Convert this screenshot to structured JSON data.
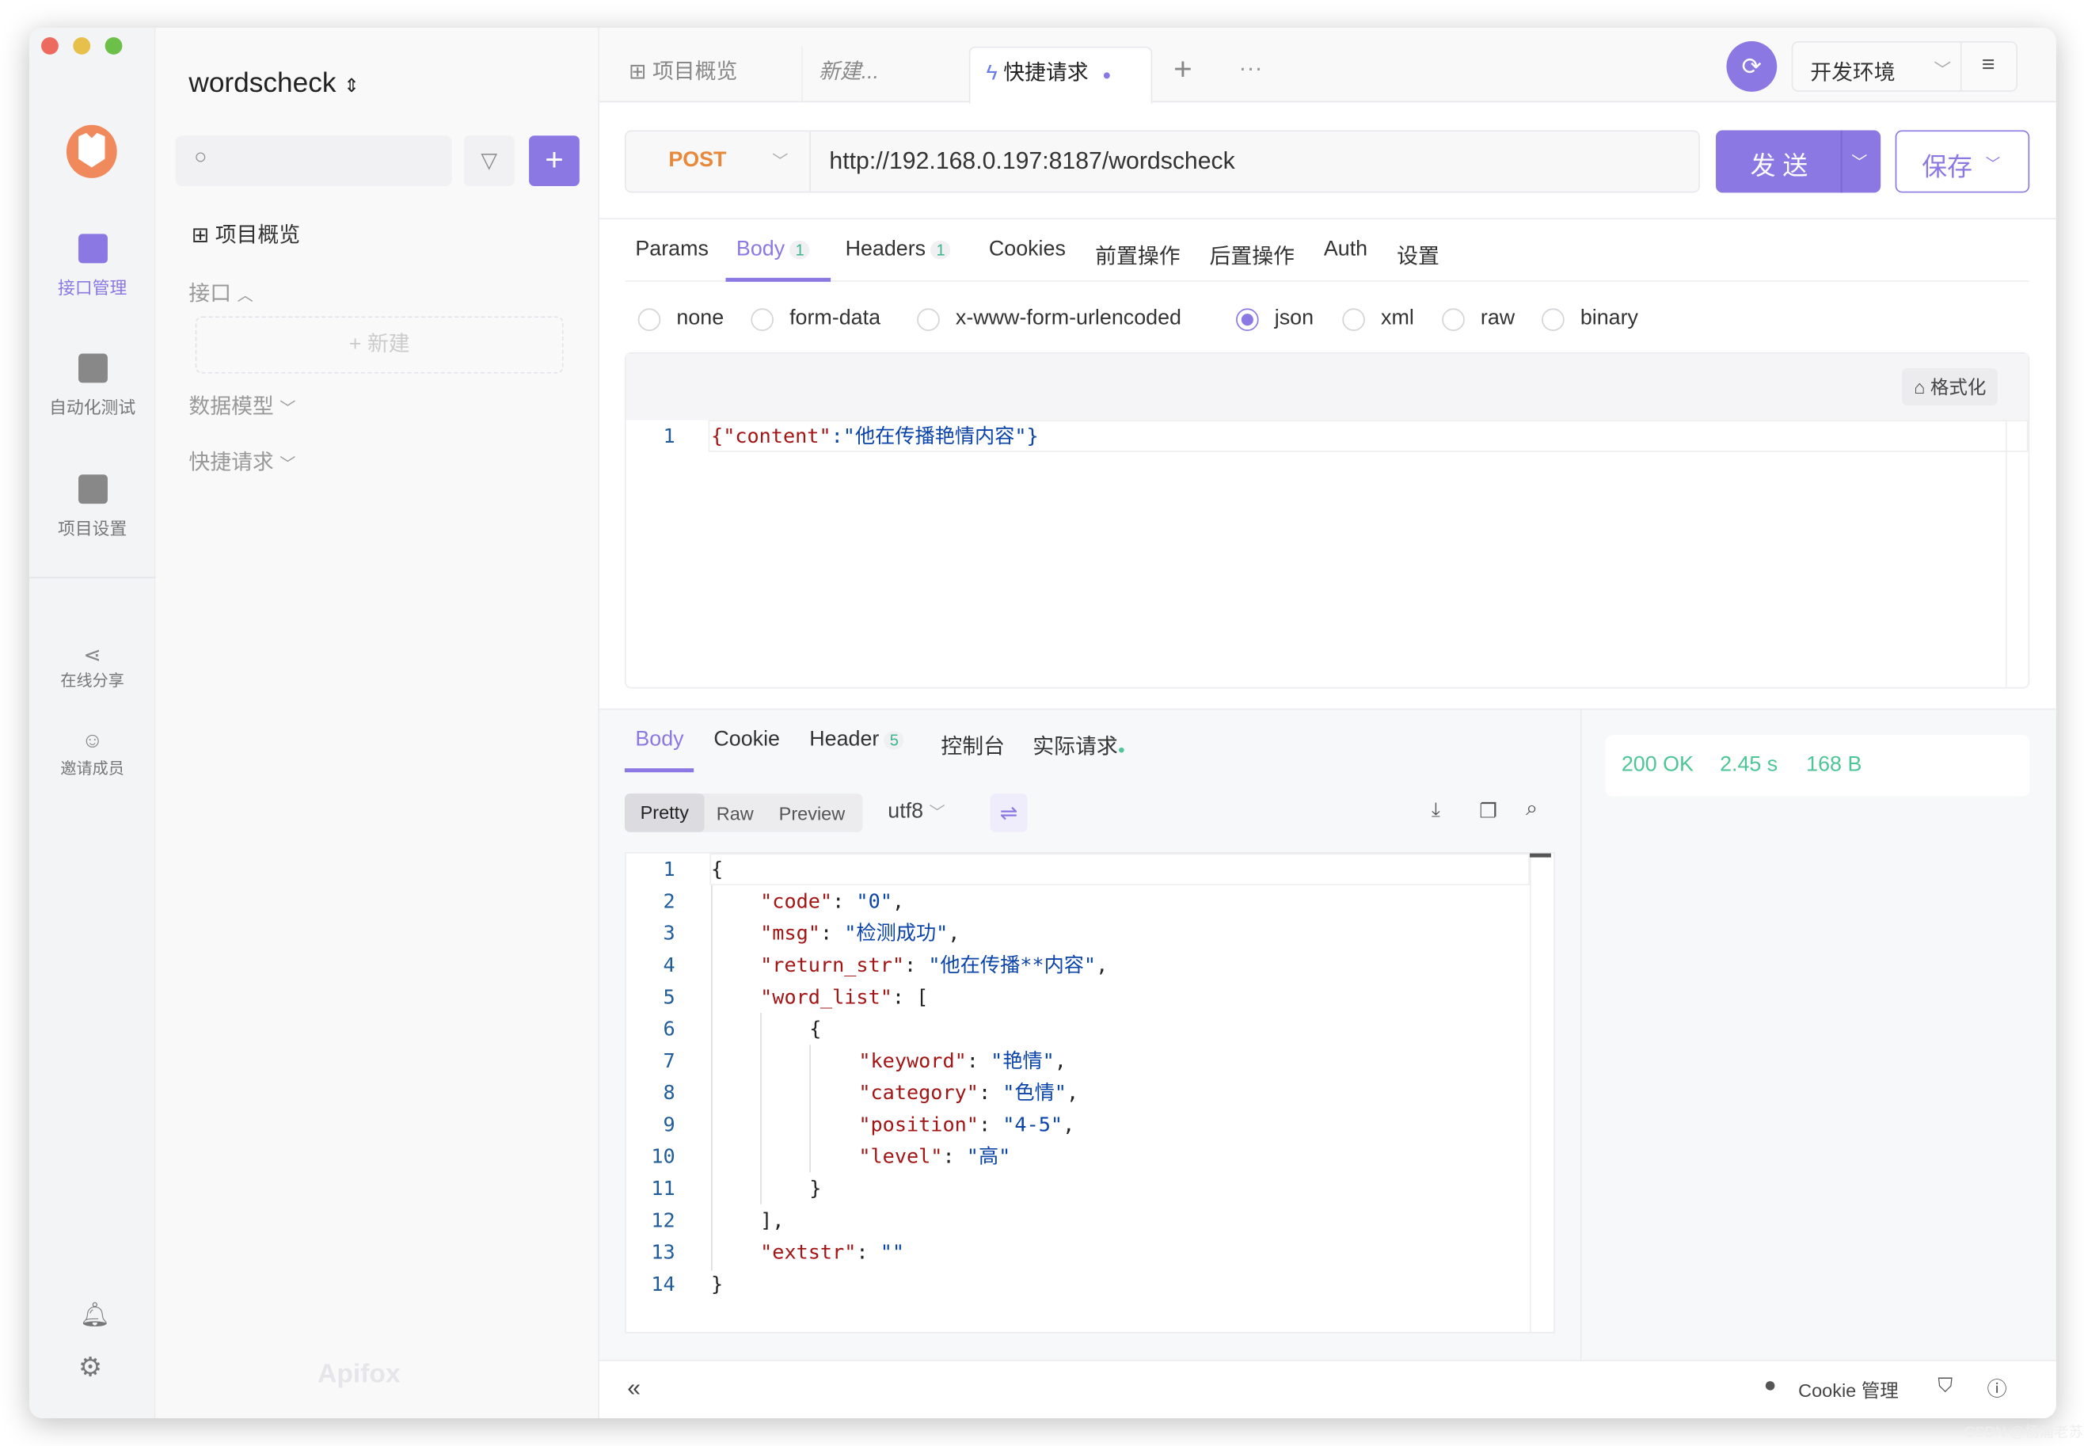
{
  "window": {
    "traffic_lights": [
      "#ed6a5e",
      "#e6c04a",
      "#6cc04a"
    ]
  },
  "rail": {
    "items": [
      {
        "label": "接口管理",
        "icon": "api-management-icon",
        "active": true
      },
      {
        "label": "自动化测试",
        "icon": "automation-test-icon"
      },
      {
        "label": "项目设置",
        "icon": "project-settings-icon"
      },
      {
        "label": "在线分享",
        "icon": "share-icon"
      },
      {
        "label": "邀请成员",
        "icon": "invite-member-icon"
      }
    ],
    "bottom_icons": [
      "bell-icon",
      "gear-icon"
    ]
  },
  "sidebar": {
    "project": "wordscheck",
    "search_placeholder": "",
    "overview": "项目概览",
    "sections": [
      {
        "label": "接口",
        "expanded": true
      },
      {
        "label": "数据模型"
      },
      {
        "label": "快捷请求"
      }
    ],
    "new_label": "新建",
    "logo_text": "Apifox"
  },
  "tabs": [
    {
      "label": "项目概览"
    },
    {
      "label": "新建..."
    },
    {
      "label": "快捷请求",
      "active": true
    }
  ],
  "env": {
    "label": "开发环境"
  },
  "request": {
    "method": "POST",
    "url": "http://192.168.0.197:8187/wordscheck",
    "send": "发 送",
    "save": "保存"
  },
  "req_tabs": [
    {
      "label": "Params"
    },
    {
      "label": "Body",
      "badge": "1",
      "active": true
    },
    {
      "label": "Headers",
      "badge": "1"
    },
    {
      "label": "Cookies"
    },
    {
      "label": "前置操作"
    },
    {
      "label": "后置操作"
    },
    {
      "label": "Auth"
    },
    {
      "label": "设置"
    }
  ],
  "body_types": [
    {
      "label": "none"
    },
    {
      "label": "form-data"
    },
    {
      "label": "x-www-form-urlencoded"
    },
    {
      "label": "json",
      "selected": true
    },
    {
      "label": "xml"
    },
    {
      "label": "raw"
    },
    {
      "label": "binary"
    }
  ],
  "editor": {
    "format_label": "格式化",
    "lines": [
      {
        "n": "1",
        "k": "{\"content\"",
        "s": ":\"他在传播艳情内容\"}"
      }
    ]
  },
  "res_tabs": [
    {
      "label": "Body",
      "active": true
    },
    {
      "label": "Cookie"
    },
    {
      "label": "Header",
      "badge": "5"
    },
    {
      "label": "控制台"
    },
    {
      "label": "实际请求"
    }
  ],
  "view_modes": [
    "Pretty",
    "Raw",
    "Preview"
  ],
  "encoding": "utf8",
  "response_lines": [
    {
      "n": "1",
      "indent": 0,
      "p": "{"
    },
    {
      "n": "2",
      "indent": 1,
      "k": "\"code\"",
      "p": ": ",
      "s": "\"0\"",
      "e": ","
    },
    {
      "n": "3",
      "indent": 1,
      "k": "\"msg\"",
      "p": ": ",
      "s": "\"检测成功\"",
      "e": ","
    },
    {
      "n": "4",
      "indent": 1,
      "k": "\"return_str\"",
      "p": ": ",
      "s": "\"他在传播**内容\"",
      "e": ","
    },
    {
      "n": "5",
      "indent": 1,
      "k": "\"word_list\"",
      "p": ": ["
    },
    {
      "n": "6",
      "indent": 2,
      "p": "{"
    },
    {
      "n": "7",
      "indent": 3,
      "k": "\"keyword\"",
      "p": ": ",
      "s": "\"艳情\"",
      "e": ","
    },
    {
      "n": "8",
      "indent": 3,
      "k": "\"category\"",
      "p": ": ",
      "s": "\"色情\"",
      "e": ","
    },
    {
      "n": "9",
      "indent": 3,
      "k": "\"position\"",
      "p": ": ",
      "s": "\"4-5\"",
      "e": ","
    },
    {
      "n": "10",
      "indent": 3,
      "k": "\"level\"",
      "p": ": ",
      "s": "\"高\""
    },
    {
      "n": "11",
      "indent": 2,
      "p": "}"
    },
    {
      "n": "12",
      "indent": 1,
      "p": "],"
    },
    {
      "n": "13",
      "indent": 1,
      "k": "\"extstr\"",
      "p": ": ",
      "s": "\"\""
    },
    {
      "n": "14",
      "indent": 0,
      "p": "}"
    }
  ],
  "status": {
    "code": "200 OK",
    "time": "2.45 s",
    "size": "168 B",
    "color": "#4dc597"
  },
  "footer": {
    "cookie_label": "Cookie 管理"
  },
  "watermark": "CSDN @杨浦老苏",
  "colors": {
    "accent": "#8c78e3",
    "method": "#e8883a"
  }
}
